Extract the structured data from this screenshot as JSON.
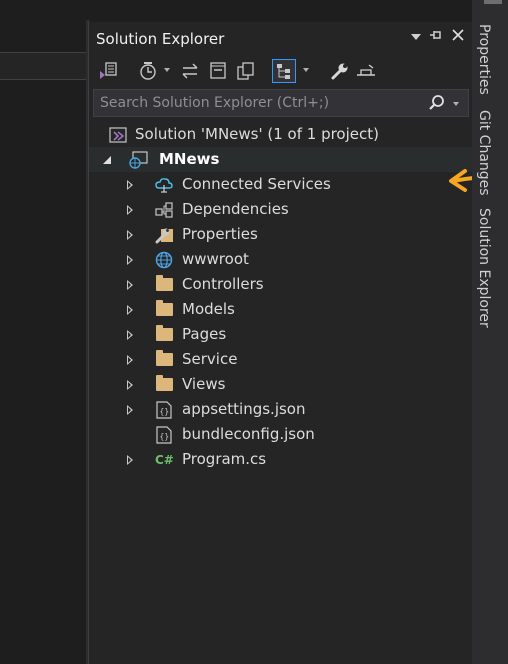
{
  "panel": {
    "title": "Solution Explorer",
    "title_buttons": [
      "window-position-icon",
      "pin-icon",
      "close-icon"
    ],
    "toolbar_icons": [
      "switch-views-icon",
      "pending-changes-filter-icon",
      "sync-with-active-document-icon",
      "collapse-all-icon",
      "show-all-files-icon",
      "preview-selected-items-icon",
      "properties-icon",
      "settings-icon"
    ],
    "search": {
      "placeholder": "Search Solution Explorer (Ctrl+;)"
    }
  },
  "tree": {
    "solution_label": "Solution 'MNews' (1 of 1 project)",
    "project_label": "MNews",
    "items": [
      {
        "label": "Connected Services",
        "icon": "connected-services-icon",
        "expandable": true
      },
      {
        "label": "Dependencies",
        "icon": "dependencies-icon",
        "expandable": true
      },
      {
        "label": "Properties",
        "icon": "properties-wrench-icon",
        "expandable": true
      },
      {
        "label": "wwwroot",
        "icon": "globe-icon",
        "expandable": true
      },
      {
        "label": "Controllers",
        "icon": "folder-icon",
        "expandable": true
      },
      {
        "label": "Models",
        "icon": "folder-icon",
        "expandable": true
      },
      {
        "label": "Pages",
        "icon": "folder-icon",
        "expandable": true
      },
      {
        "label": "Service",
        "icon": "folder-icon",
        "expandable": true
      },
      {
        "label": "Views",
        "icon": "folder-icon",
        "expandable": true
      },
      {
        "label": "appsettings.json",
        "icon": "json-file-icon",
        "expandable": true
      },
      {
        "label": "bundleconfig.json",
        "icon": "json-file-icon",
        "expandable": false
      },
      {
        "label": "Program.cs",
        "icon": "csharp-file-icon",
        "expandable": true
      }
    ]
  },
  "side_tabs": [
    "Properties",
    "Git Changes",
    "Solution Explorer"
  ],
  "colors": {
    "accent": "#3399ff",
    "folder": "#dcb67a",
    "annotation_arrow": "#f5a623",
    "vs_purple": "#a074c4"
  }
}
